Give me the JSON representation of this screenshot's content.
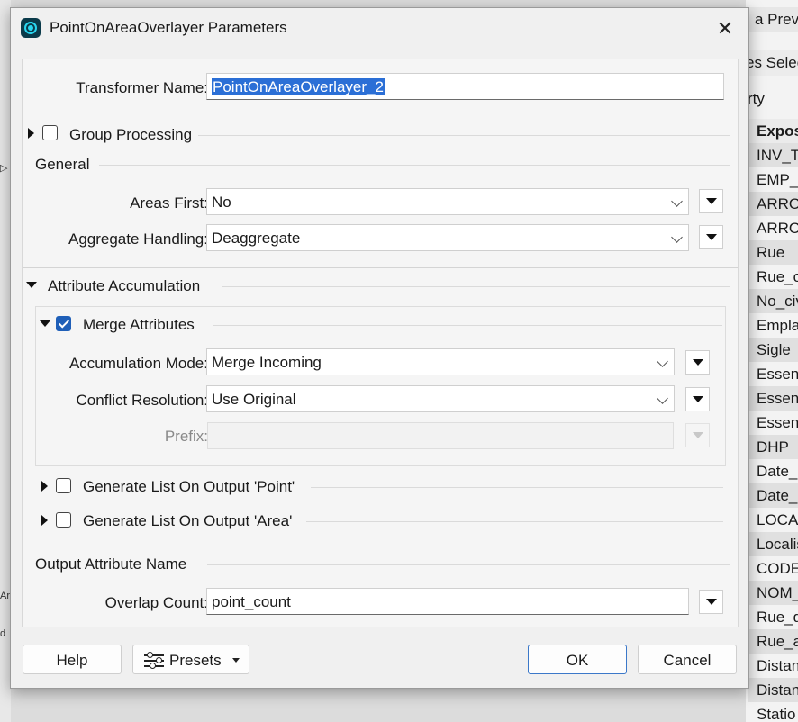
{
  "background": {
    "right_tabs": [
      "a Previe",
      "es Selec"
    ],
    "property_label": "rty",
    "list_header": "Expos",
    "list_items": [
      "INV_T",
      "EMP_N",
      "ARRO",
      "ARRO",
      "Rue",
      "Rue_c",
      "No_civ",
      "Empla",
      "Sigle",
      "Essenc",
      "Essenc",
      "Essenc",
      "DHP",
      "Date_I",
      "Date_I",
      "LOCAL",
      "Localis",
      "CODE_",
      "NOM_",
      "Rue_d",
      "Rue_a",
      "Distan",
      "Distan",
      "Statio"
    ],
    "left_marks": [
      "▷",
      "Ar",
      "d"
    ]
  },
  "dialog": {
    "title": "PointOnAreaOverlayer Parameters",
    "close_glyph": "✕",
    "transformer_name_label": "Transformer Name:",
    "transformer_name_value": "PointOnAreaOverlayer_2",
    "group_processing_label": "Group Processing",
    "general": {
      "header": "General",
      "areas_first_label": "Areas First:",
      "areas_first_value": "No",
      "aggregate_label": "Aggregate Handling:",
      "aggregate_value": "Deaggregate"
    },
    "attribute_accumulation": {
      "header": "Attribute Accumulation",
      "merge_label": "Merge Attributes",
      "merge_checked": true,
      "accumulation_mode_label": "Accumulation Mode:",
      "accumulation_mode_value": "Merge Incoming",
      "conflict_label": "Conflict Resolution:",
      "conflict_value": "Use Original",
      "prefix_label": "Prefix:",
      "prefix_value": "",
      "list_point_label": "Generate List On Output 'Point'",
      "list_area_label": "Generate List On Output 'Area'"
    },
    "output": {
      "header": "Output Attribute Name",
      "overlap_label": "Overlap Count:",
      "overlap_value": "point_count"
    },
    "buttons": {
      "help": "Help",
      "presets": "Presets",
      "ok": "OK",
      "cancel": "Cancel"
    }
  }
}
